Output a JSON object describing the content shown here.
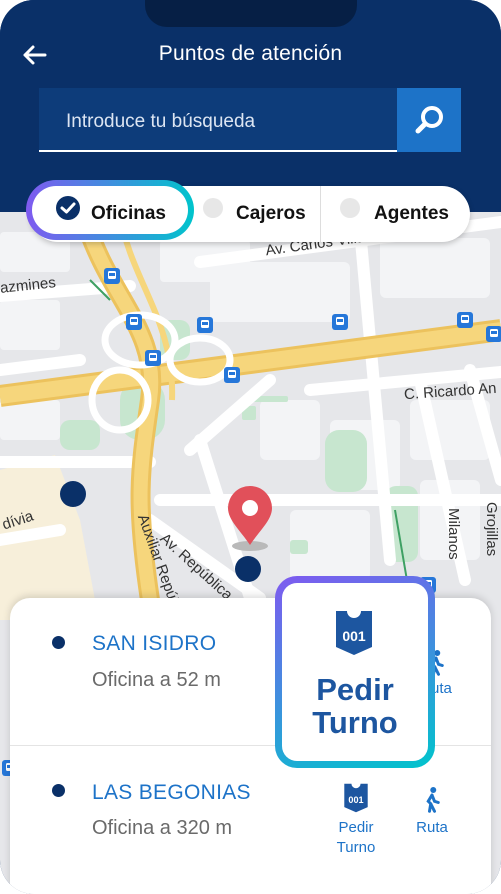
{
  "header": {
    "title": "Puntos de atención"
  },
  "search": {
    "placeholder": "Introduce tu búsqueda"
  },
  "filters": [
    {
      "label": "Oficinas",
      "selected": true
    },
    {
      "label": "Cajeros",
      "selected": false
    },
    {
      "label": "Agentes",
      "selected": false
    }
  ],
  "map": {
    "street_labels": [
      "Av. Carlos Villarán",
      "C. Ricardo An",
      "Auxiliar República de",
      "Av. República d",
      "Milanos",
      "Grojillas",
      "azmines",
      "dívia",
      "Ruta"
    ]
  },
  "offices": [
    {
      "name": "SAN ISIDRO",
      "distance": "Oficina a 52 m"
    },
    {
      "name": "LAS BEGONIAS",
      "distance": "Oficina a 320 m"
    }
  ],
  "actions": {
    "turn_ticket_number": "001",
    "turn_label_line1": "Pedir",
    "turn_label_line2": "Turno",
    "route_label": "Ruta"
  },
  "colors": {
    "header_bg": "#0a3068",
    "accent": "#1d73c8",
    "highlight_gradient_start": "#7f5af0",
    "highlight_gradient_end": "#00c4cc",
    "map_pin": "#e1505a"
  }
}
